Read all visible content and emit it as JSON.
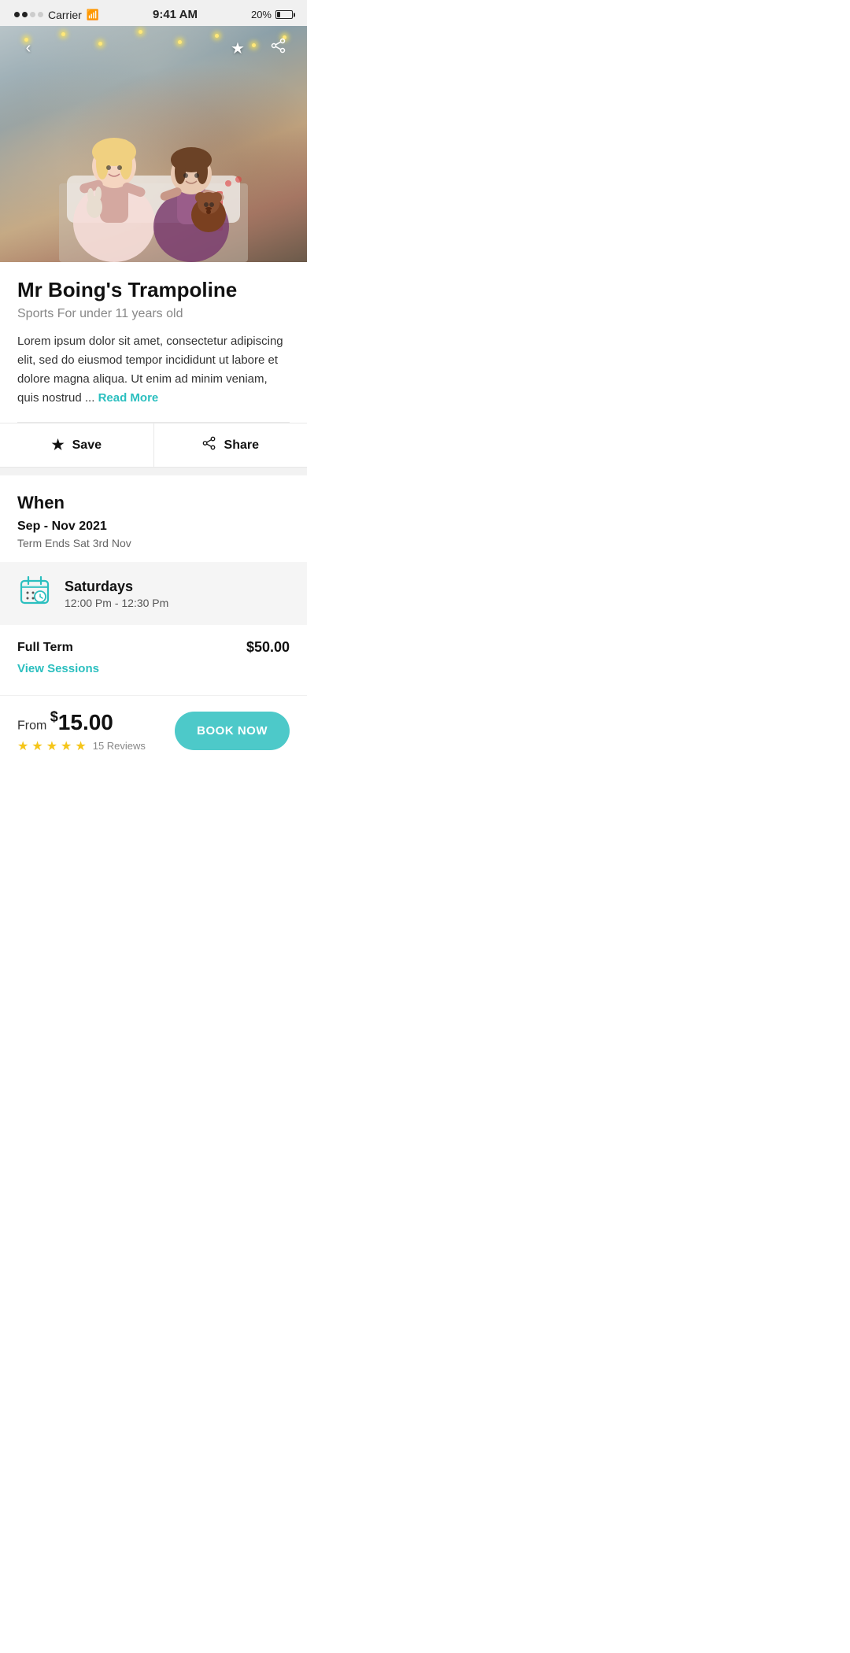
{
  "status_bar": {
    "carrier": "Carrier",
    "time": "9:41 AM",
    "battery_percent": "20%"
  },
  "hero": {
    "back_icon": "‹",
    "save_icon": "★",
    "share_icon": "⬆"
  },
  "title": "Mr Boing's Trampoline",
  "subtitle": "Sports For under 11 years old",
  "description": "Lorem ipsum dolor sit amet, consectetur adipiscing elit, sed do eiusmod tempor incididunt ut labore et dolore magna aliqua. Ut enim ad minim veniam, quis nostrud ...",
  "read_more_label": "Read More",
  "actions": {
    "save_label": "Save",
    "share_label": "Share"
  },
  "when_section": {
    "heading": "When",
    "date_range": "Sep - Nov 2021",
    "term_end": "Term Ends Sat 3rd Nov"
  },
  "schedule": {
    "day": "Saturdays",
    "time": "12:00 Pm - 12:30 Pm"
  },
  "pricing": {
    "label": "Full Term",
    "amount": "$50.00",
    "view_sessions_label": "View Sessions"
  },
  "bottom_bar": {
    "from_label": "From",
    "currency": "$",
    "price": "15.00",
    "stars": 5,
    "reviews_count": "15 Reviews",
    "book_button_label": "BOOK NOW"
  }
}
